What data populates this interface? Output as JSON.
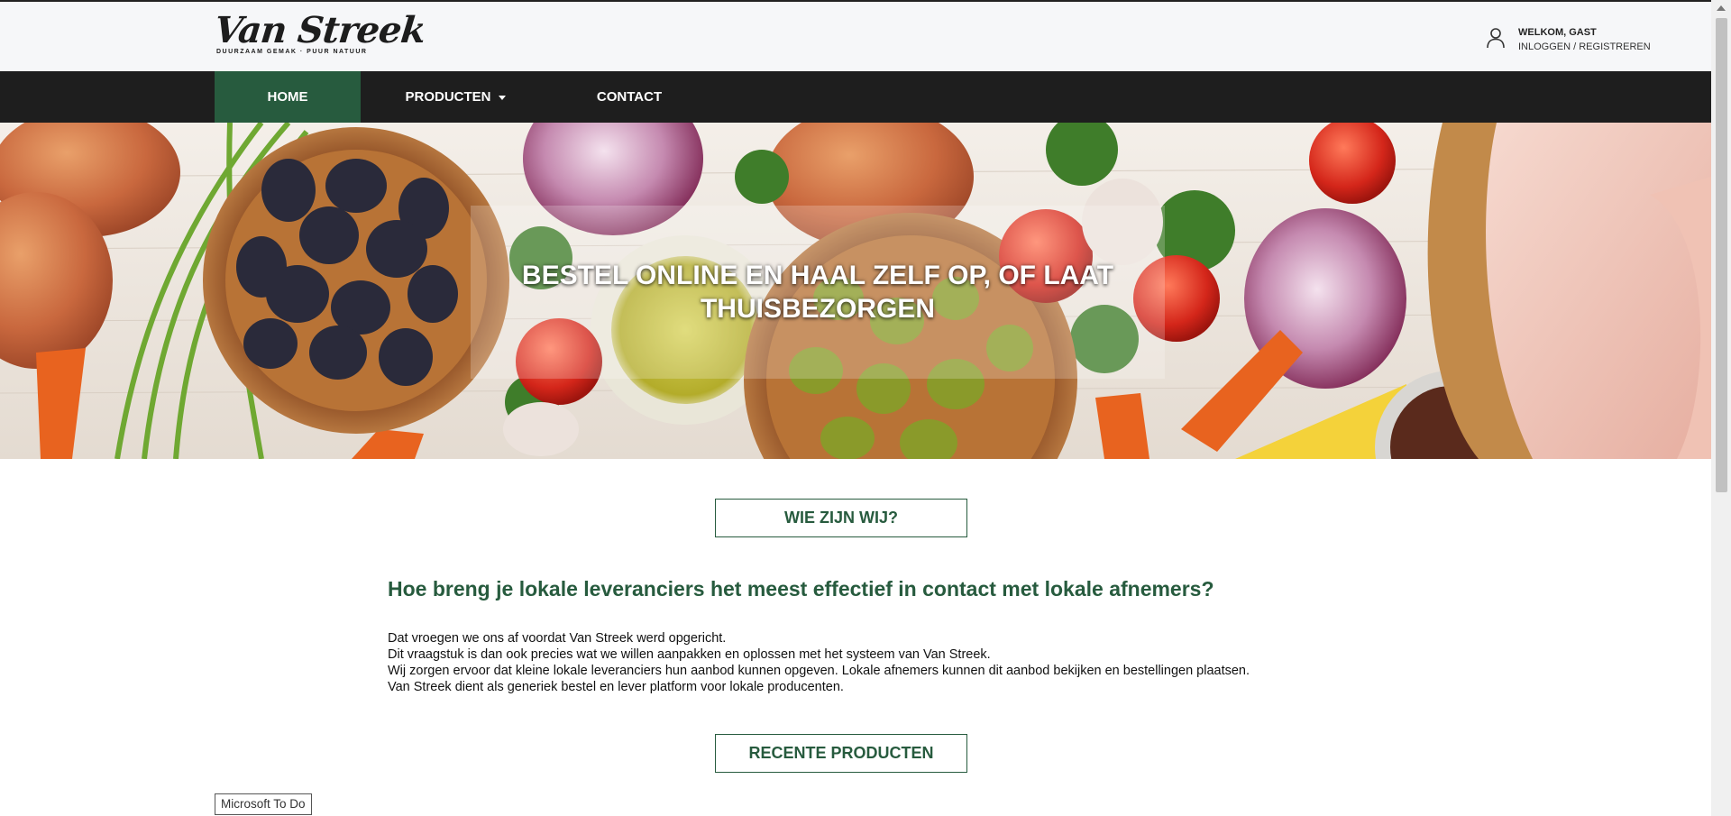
{
  "brand": {
    "name": "Van Streek",
    "tagline": "DUURZAAM GEMAK · PUUR NATUUR"
  },
  "user": {
    "welcome": "WELKOM, GAST",
    "login": "INLOGGEN / REGISTREREN",
    "icon": "user-icon"
  },
  "nav": {
    "home": "HOME",
    "products": "PRODUCTEN",
    "contact": "CONTACT"
  },
  "hero": {
    "title": "BESTEL ONLINE EN HAAL ZELF OP, OF LAAT THUISBEZORGEN"
  },
  "about": {
    "button": "WIE ZIJN WIJ?",
    "heading": "Hoe breng je lokale leveranciers het meest effectief in contact met lokale afnemers?",
    "lines": [
      "Dat vroegen we ons af voordat Van Streek werd opgericht.",
      "Dit vraagstuk is dan ook precies wat we willen aanpakken en oplossen met het systeem van Van Streek.",
      "Wij zorgen ervoor dat kleine lokale leveranciers hun aanbod kunnen opgeven. Lokale afnemers kunnen dit aanbod bekijken en bestellingen plaatsen.",
      "Van Streek dient als generiek bestel en lever platform voor lokale producenten."
    ]
  },
  "recent": {
    "button": "RECENTE PRODUCTEN"
  },
  "taskbar": {
    "todo": "Microsoft To Do"
  },
  "colors": {
    "accent_green": "#275b3e",
    "nav_bg": "#1e1e1e",
    "header_bg": "#f6f7f9"
  }
}
